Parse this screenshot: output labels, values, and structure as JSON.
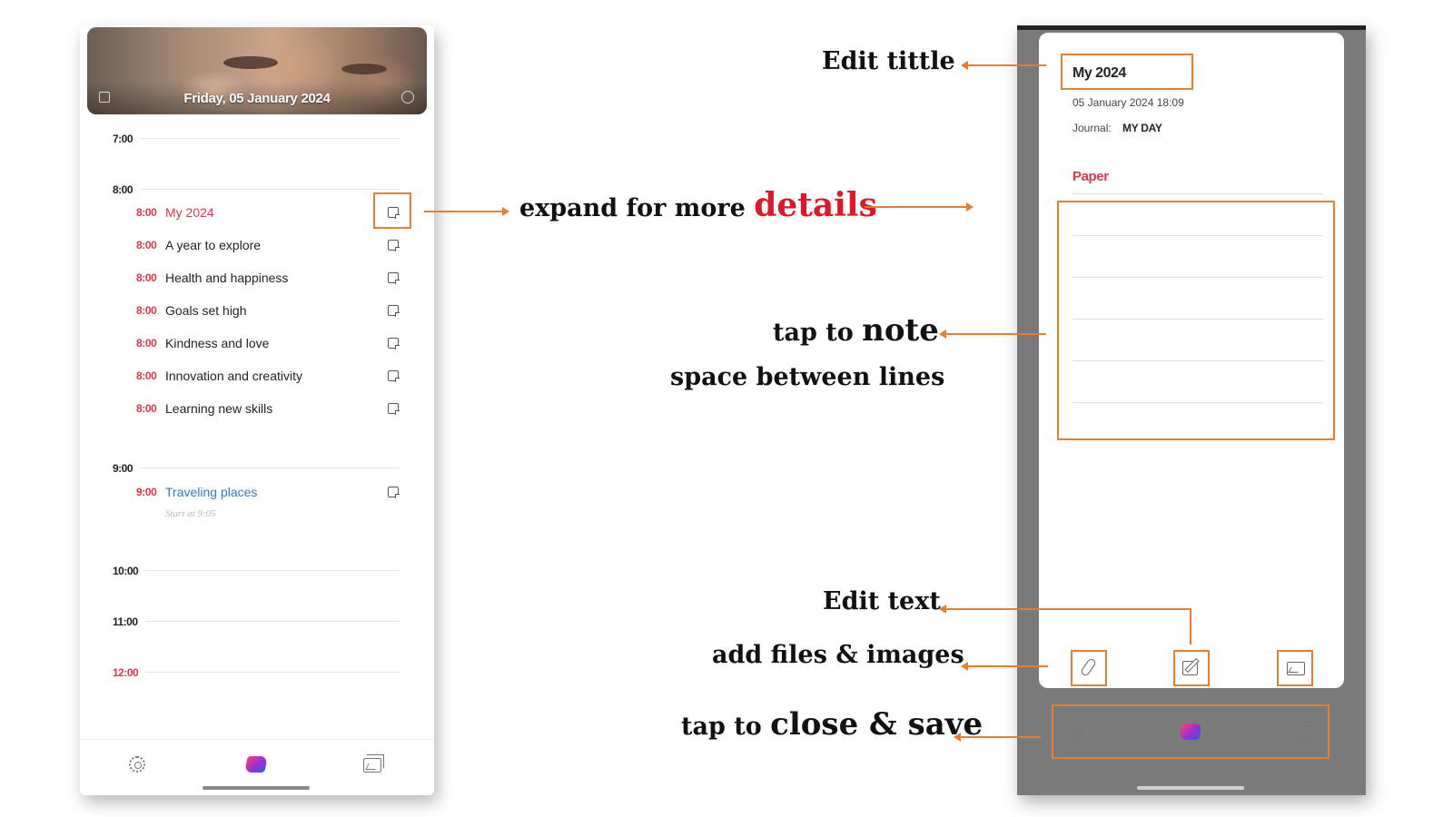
{
  "left_screen": {
    "header_date": "Friday, 05 January 2024",
    "hours": [
      "7:00",
      "8:00",
      "9:00",
      "10:00",
      "11:00",
      "12:00"
    ],
    "events_8": [
      {
        "time": "8:00",
        "title": "My 2024",
        "highlight": true
      },
      {
        "time": "8:00",
        "title": "A year to explore"
      },
      {
        "time": "8:00",
        "title": "Health and happiness"
      },
      {
        "time": "8:00",
        "title": "Goals set high"
      },
      {
        "time": "8:00",
        "title": "Kindness and love"
      },
      {
        "time": "8:00",
        "title": "Innovation and creativity"
      },
      {
        "time": "8:00",
        "title": "Learning new skills"
      }
    ],
    "events_9": [
      {
        "time": "9:00",
        "title": "Traveling places",
        "subtitle": "Start at 9:05"
      }
    ],
    "icons": {
      "settings": "gear-icon",
      "logo": "app-logo-icon",
      "gallery": "gallery-icon",
      "expand": "expand-note-icon"
    },
    "colors": {
      "event_time": "#d9394c",
      "highlight_title": "#d9394c",
      "link_title": "#2a7fc1"
    }
  },
  "right_screen": {
    "title": "My 2024",
    "date": "05 January 2024 18:09",
    "journal_label": "Journal:",
    "journal_value": "MY DAY",
    "paper_label": "Paper",
    "tools": {
      "attach": "paperclip-icon",
      "edit": "edit-icon",
      "image": "image-icon"
    }
  },
  "annotations": {
    "edit_title": "Edit tittle",
    "expand_prefix": "expand for more",
    "expand_emphasis": "details",
    "tap_prefix": "tap to",
    "tap_emphasis": "note",
    "space_lines": "space between lines",
    "edit_text": "Edit text",
    "add_files": "add files & images",
    "close_prefix": "tap to",
    "close_emphasis": "close & save"
  },
  "accent_color": "#e67e2e"
}
